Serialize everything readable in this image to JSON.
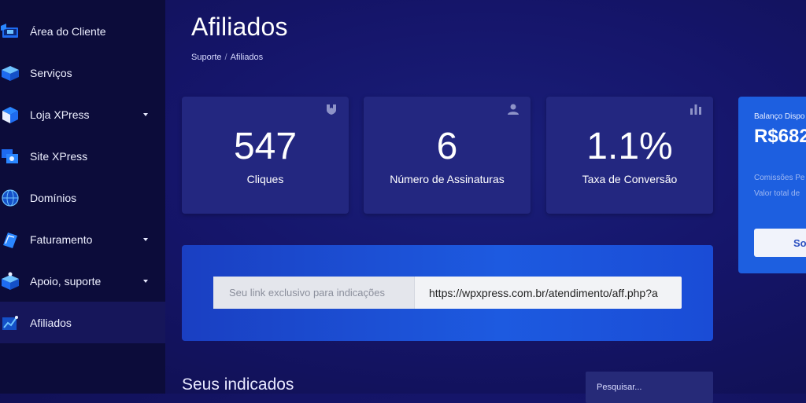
{
  "sidebar": {
    "items": [
      {
        "label": "Área do Cliente",
        "icon": "client-area-icon",
        "has_caret": false
      },
      {
        "label": "Serviços",
        "icon": "services-box-icon",
        "has_caret": false
      },
      {
        "label": "Loja XPress",
        "icon": "store-cube-icon",
        "has_caret": true
      },
      {
        "label": "Site XPress",
        "icon": "site-windows-icon",
        "has_caret": false
      },
      {
        "label": "Domínios",
        "icon": "globe-icon",
        "has_caret": false
      },
      {
        "label": "Faturamento",
        "icon": "invoice-icon",
        "has_caret": true
      },
      {
        "label": "Apoio, suporte",
        "icon": "support-box-icon",
        "has_caret": true
      },
      {
        "label": "Afiliados",
        "icon": "affiliate-chart-icon",
        "has_caret": false,
        "active": true
      }
    ]
  },
  "header": {
    "title": "Afiliados",
    "breadcrumb": [
      "Suporte",
      "Afiliados"
    ],
    "breadcrumb_separator": "/"
  },
  "stats": [
    {
      "value": "547",
      "label": "Cliques",
      "icon": "shield-badge-icon"
    },
    {
      "value": "6",
      "label": "Número de Assinaturas",
      "icon": "user-icon"
    },
    {
      "value": "1.1%",
      "label": "Taxa de Conversão",
      "icon": "bar-chart-icon"
    }
  ],
  "balance": {
    "label": "Balanço Dispo",
    "value": "R$682",
    "line1": "Comissões Pe",
    "line2": "Valor total de",
    "button_label": "So"
  },
  "referral": {
    "label": "Seu link exclusivo para indicações",
    "url": "https://wpxpress.com.br/atendimento/aff.php?a"
  },
  "referrals_section": {
    "title": "Seus indicados",
    "search_placeholder": "Pesquisar..."
  },
  "colors": {
    "background": "#15156a",
    "sidebar": "#0c0c3a",
    "card": "#232780",
    "accent_blue": "#1d5fe0"
  }
}
